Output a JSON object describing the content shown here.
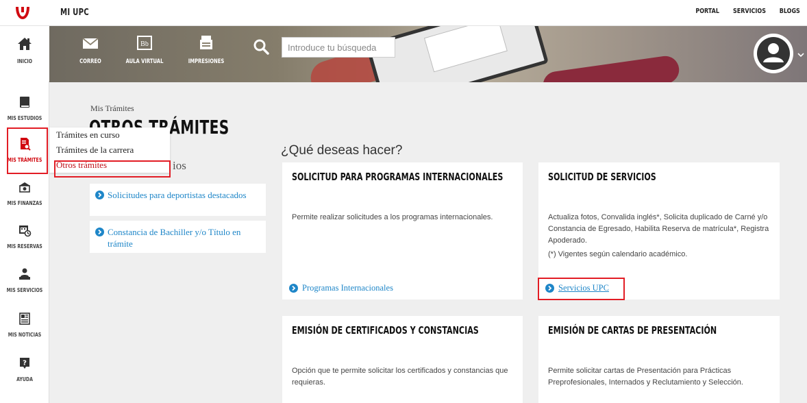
{
  "header": {
    "app_title": "MI UPC",
    "links": [
      "PORTAL",
      "SERVICIOS",
      "BLOGS"
    ]
  },
  "sidebar": {
    "items": [
      {
        "label": "INICIO",
        "icon": "home-icon"
      },
      {
        "label": "MIS ESTUDIOS",
        "icon": "book-icon"
      },
      {
        "label": "MIS TRÁMITES",
        "icon": "document-search-icon"
      },
      {
        "label": "MIS FINANZAS",
        "icon": "money-icon"
      },
      {
        "label": "MIS RESERVAS",
        "icon": "calendar-clock-icon"
      },
      {
        "label": "MIS SERVICIOS",
        "icon": "service-desk-icon"
      },
      {
        "label": "MIS NOTICIAS",
        "icon": "newspaper-icon"
      },
      {
        "label": "AYUDA",
        "icon": "help-icon"
      }
    ]
  },
  "banner": {
    "shortcuts": [
      {
        "label": "CORREO",
        "icon": "mail-icon"
      },
      {
        "label": "AULA VIRTUAL",
        "icon": "blackboard-icon"
      },
      {
        "label": "IMPRESIONES",
        "icon": "printer-icon"
      }
    ],
    "search_placeholder": "Introduce tu búsqueda"
  },
  "breadcrumb": "Mis Trámites",
  "page_title": "OTROS TRÁMITES",
  "dropdown": {
    "items": [
      "Trámites en curso",
      "Trámites de la carrera",
      "Otros trámites"
    ],
    "selected": "Otros trámites"
  },
  "left_panel": {
    "subtitle_fragment": "ios",
    "links": [
      "Solicitudes para deportistas destacados",
      "Constancia de Bachiller y/o Título en trámite"
    ]
  },
  "main": {
    "question": "¿Qué deseas hacer?",
    "cards": [
      {
        "title": "SOLICITUD PARA PROGRAMAS INTERNACIONALES",
        "description": "Permite realizar solicitudes a los programas internacionales.",
        "link": "Programas Internacionales"
      },
      {
        "title": "SOLICITUD DE SERVICIOS",
        "description": "Actualiza fotos, Convalida inglés*, Solicita duplicado de Carné y/o Constancia de Egresado, Habilita Reserva de matrícula*, Registra Apoderado.",
        "note": "(*) Vigentes según calendario académico.",
        "link": "Servicios UPC"
      },
      {
        "title": "EMISIÓN DE CERTIFICADOS Y CONSTANCIAS",
        "description": "Opción que te permite solicitar los certificados y constancias que requieras."
      },
      {
        "title": "EMISIÓN DE CARTAS DE PRESENTACIÓN",
        "description": "Permite solicitar cartas de Presentación para Prácticas Preprofesionales, Internados y Reclutamiento y Selección."
      }
    ]
  },
  "colors": {
    "accent_red": "#d10a11",
    "link_blue": "#1e86c8",
    "highlight_red": "#e21c24"
  }
}
